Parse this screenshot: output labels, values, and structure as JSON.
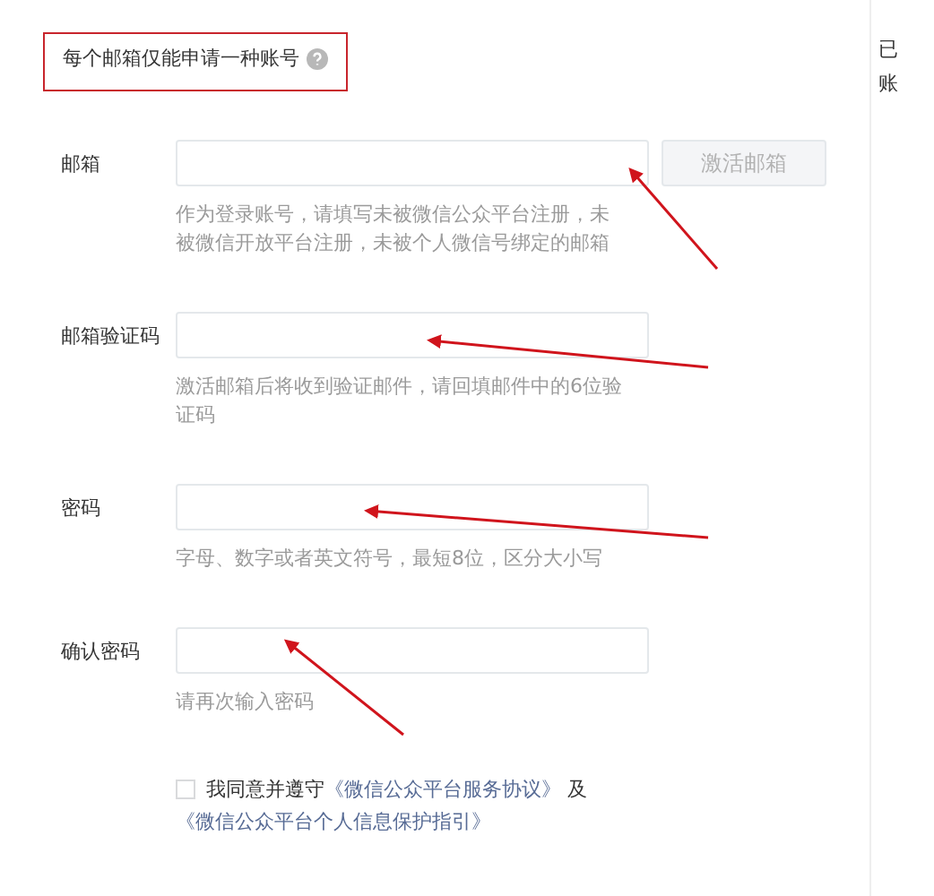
{
  "notice": {
    "text": "每个邮箱仅能申请一种账号"
  },
  "fields": [
    {
      "label": "邮箱",
      "hint": "作为登录账号，请填写未被微信公众平台注册，未被微信开放平台注册，未被个人微信号绑定的邮箱",
      "button": {
        "label": "激活邮箱",
        "disabled": true
      }
    },
    {
      "label": "邮箱验证码",
      "hint": "激活邮箱后将收到验证邮件，请回填邮件中的6位验证码"
    },
    {
      "label": "密码",
      "hint": "字母、数字或者英文符号，最短8位，区分大小写"
    },
    {
      "label": "确认密码",
      "hint": "请再次输入密码"
    }
  ],
  "agreement": {
    "checked": false,
    "prefix": "我同意并遵守",
    "link_1": "《微信公众平台服务协议》",
    "conjunction": "及",
    "link_2": "《微信公众平台个人信息保护指引》"
  },
  "side_panel": {
    "lines": [
      "已",
      "账"
    ]
  }
}
